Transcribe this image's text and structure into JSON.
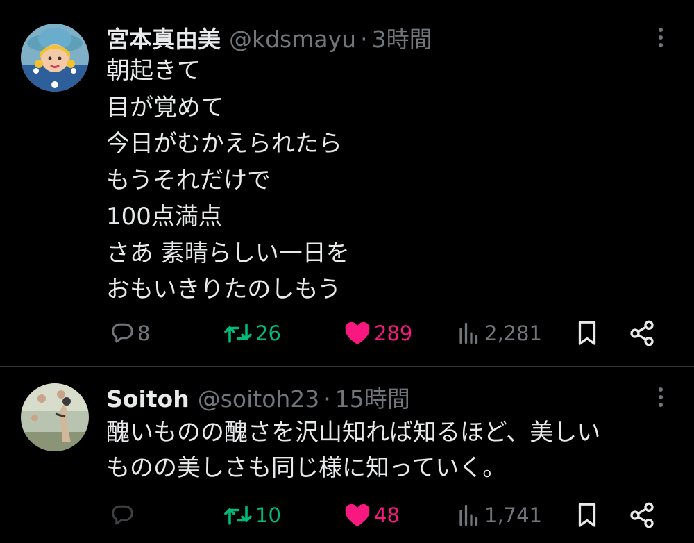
{
  "colors": {
    "background": "#000000",
    "text": "#e7e9ea",
    "secondary_text": "#71767b",
    "retweet": "#00ba7c",
    "like": "#f91880"
  },
  "tweets": [
    {
      "name": "宮本真由美",
      "handle": "@kdsmayu",
      "separator": "·",
      "time": "3時間",
      "lines": [
        "朝起きて",
        "目が覚めて",
        "今日がむかえられたら",
        "もうそれだけで",
        "100点満点",
        "さあ 素晴らしい一日を",
        "おもいきりたのしもう"
      ],
      "replies": "8",
      "retweets": "26",
      "likes": "289",
      "views": "2,281",
      "liked": true,
      "retweeted": true
    },
    {
      "name": "Soitoh",
      "handle": "@soitoh23",
      "separator": "·",
      "time": "15時間",
      "lines": [
        "醜いものの醜さを沢山知れば知るほど、美しい",
        "ものの美しさも同じ様に知っていく。"
      ],
      "replies": "",
      "retweets": "10",
      "likes": "48",
      "views": "1,741",
      "liked": true,
      "retweeted": true
    }
  ],
  "icons": {
    "reply": "speech-bubble-icon",
    "retweet": "retweet-arrows-icon",
    "like": "heart-icon",
    "views": "bar-chart-icon",
    "bookmark": "bookmark-icon",
    "share": "share-nodes-icon",
    "more": "more-vertical-icon"
  }
}
